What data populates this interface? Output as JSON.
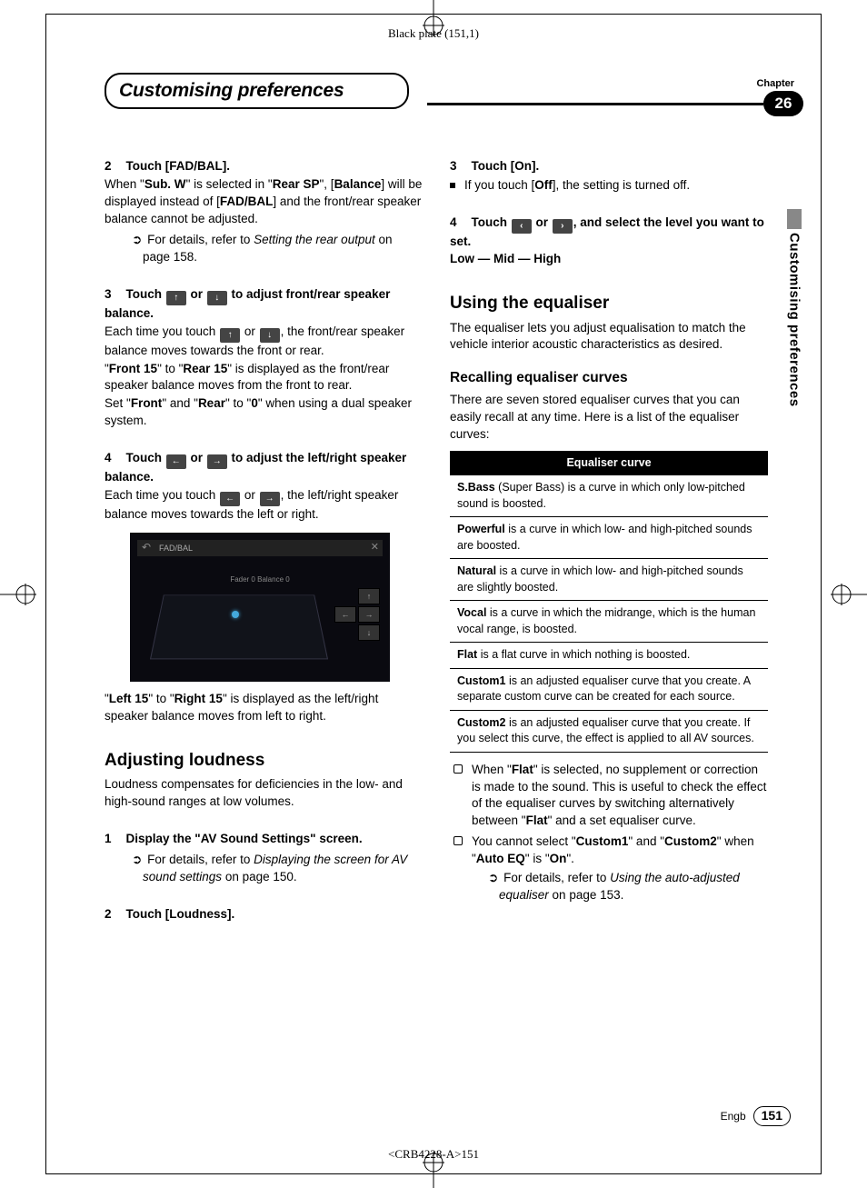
{
  "meta": {
    "plate": "Black plate (151,1)",
    "doc_code": "<CRB4228-A>151",
    "chapter_label": "Chapter",
    "chapter_num": "26",
    "lang_code": "Engb",
    "page_num": "151",
    "section_title": "Customising preferences",
    "side_tab": "Customising preferences"
  },
  "left": {
    "s2": {
      "num": "2",
      "head": "Touch [FAD/BAL].",
      "t1a": "When \"",
      "t1b": "Sub. W",
      "t1c": "\" is selected in \"",
      "t1d": "Rear SP",
      "t1e": "\",",
      "t2a": "[",
      "t2b": "Balance",
      "t2c": "] will be displayed instead of",
      "t3a": "[",
      "t3b": "FAD/BAL",
      "t3c": "] and the front/rear speaker balance cannot be adjusted.",
      "ref_a": "For details, refer to ",
      "ref_i": "Setting the rear output",
      "ref_b": " on page 158."
    },
    "s3": {
      "num": "3",
      "head_a": "Touch ",
      "head_b": " or ",
      "head_c": " to adjust front/rear speaker balance.",
      "t1a": "Each time you touch ",
      "t1b": " or ",
      "t1c": ", the front/rear speaker balance moves towards the front or rear.",
      "t2a": "\"",
      "t2b": "Front 15",
      "t2c": "\" to \"",
      "t2d": "Rear 15",
      "t2e": "\" is displayed as the front/rear speaker balance moves from the front to rear.",
      "t3a": "Set \"",
      "t3b": "Front",
      "t3c": "\" and \"",
      "t3d": "Rear",
      "t3e": "\" to \"",
      "t3f": "0",
      "t3g": "\" when using a dual speaker system."
    },
    "s4": {
      "num": "4",
      "head_a": "Touch ",
      "head_b": " or ",
      "head_c": " to adjust the left/right speaker balance.",
      "t1a": "Each time you touch ",
      "t1b": " or ",
      "t1c": ", the left/right speaker balance moves towards the left or right."
    },
    "shot": {
      "title": "FAD/BAL",
      "labels": "Fader   0    Balance   0"
    },
    "after_shot_a": "\"",
    "after_shot_b": "Left 15",
    "after_shot_c": "\" to \"",
    "after_shot_d": "Right 15",
    "after_shot_e": "\" is displayed as the left/right speaker balance moves from left to right.",
    "loud": {
      "title": "Adjusting loudness",
      "intro": "Loudness compensates for deficiencies in the low- and high-sound ranges at low volumes.",
      "s1": {
        "num": "1",
        "head": "Display the \"AV Sound Settings\" screen.",
        "ref_a": "For details, refer to ",
        "ref_i": "Displaying the screen for AV sound settings",
        "ref_b": " on page 150."
      },
      "s2": {
        "num": "2",
        "head": "Touch [Loudness]."
      }
    }
  },
  "right": {
    "s3": {
      "num": "3",
      "head": "Touch [On].",
      "bullet_a": "If you touch [",
      "bullet_b": "Off",
      "bullet_c": "], the setting is turned off."
    },
    "s4": {
      "num": "4",
      "head_a": "Touch ",
      "head_b": " or ",
      "head_c": ", and select the level you want to set.",
      "levels": "Low — Mid — High"
    },
    "eq": {
      "title": "Using the equaliser",
      "intro": "The equaliser lets you adjust equalisation to match the vehicle interior acoustic characteristics as desired.",
      "recall_title": "Recalling equaliser curves",
      "recall_intro": "There are seven stored equaliser curves that you can easily recall at any time. Here is a list of the equaliser curves:",
      "table_head": "Equaliser curve",
      "rows": [
        {
          "b": "S.Bass",
          "t": " (Super Bass) is a curve in which only low-pitched sound is boosted."
        },
        {
          "b": "Powerful",
          "t": " is a curve in which low- and high-pitched sounds are boosted."
        },
        {
          "b": "Natural",
          "t": " is a curve in which low- and high-pitched sounds are slightly boosted."
        },
        {
          "b": "Vocal",
          "t": " is a curve in which the midrange, which is the human vocal range, is boosted."
        },
        {
          "b": "Flat",
          "t": " is a flat curve in which nothing is boosted."
        },
        {
          "b": "Custom1",
          "t": " is an adjusted equaliser curve that you create. A separate custom curve can be created for each source."
        },
        {
          "b": "Custom2",
          "t": " is an adjusted equaliser curve that you create. If you select this curve, the effect is applied to all AV sources."
        }
      ],
      "note1_a": "When \"",
      "note1_b": "Flat",
      "note1_c": "\" is selected, no supplement or correction is made to the sound. This is useful to check the effect of the equaliser curves by switching alternatively between \"",
      "note1_d": "Flat",
      "note1_e": "\" and a set equaliser curve.",
      "note2_a": "You cannot select \"",
      "note2_b": "Custom1",
      "note2_c": "\" and \"",
      "note2_d": "Custom2",
      "note2_e": "\" when \"",
      "note2_f": "Auto EQ",
      "note2_g": "\" is \"",
      "note2_h": "On",
      "note2_i": "\".",
      "note2_ref_a": "For details, refer to ",
      "note2_ref_i": "Using the auto-adjusted equaliser",
      "note2_ref_b": " on page 153."
    }
  }
}
